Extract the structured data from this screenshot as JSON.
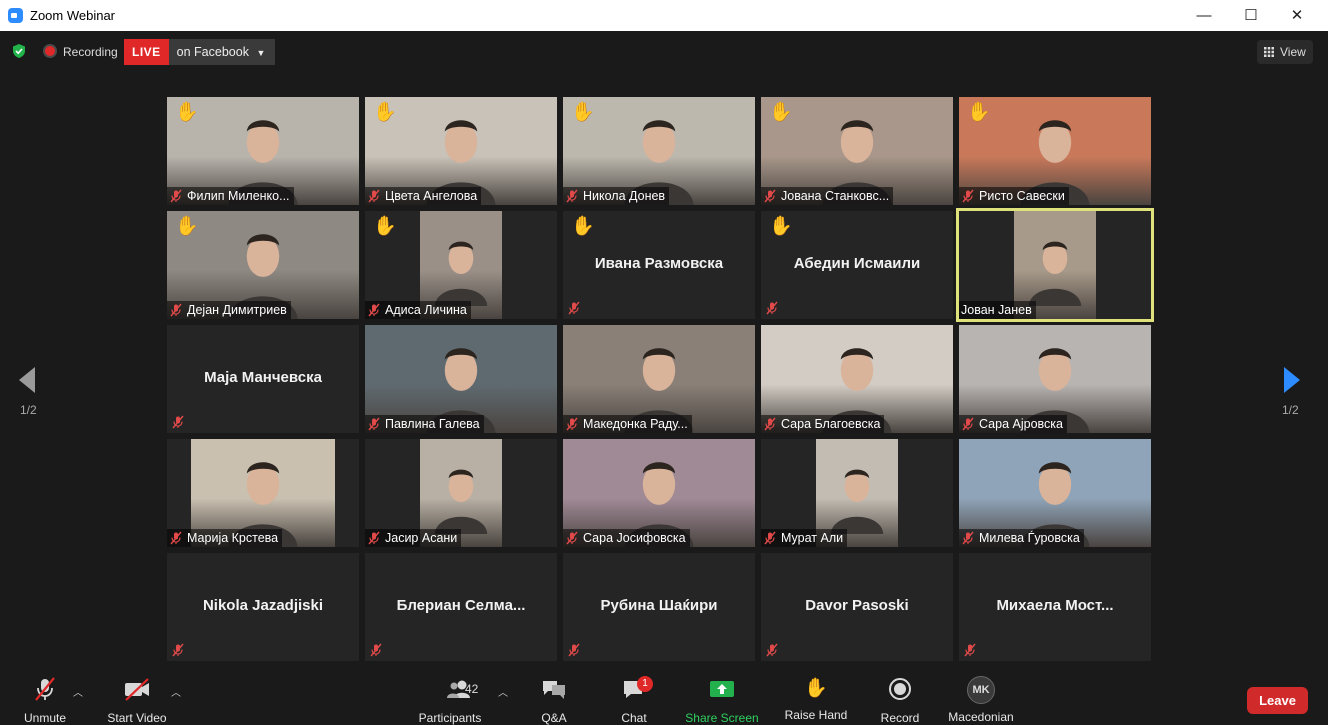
{
  "window": {
    "title": "Zoom Webinar",
    "minimize": "—",
    "maximize": "☐",
    "close": "✕"
  },
  "status": {
    "recording_label": "Recording",
    "live_label": "LIVE",
    "live_destination": "on Facebook",
    "view_label": "View"
  },
  "pagination": {
    "left_page": "1/2",
    "right_page": "1/2"
  },
  "participants": [
    {
      "name": "Филип Миленко...",
      "hand": true,
      "video": true,
      "bg": "#b8b4ac"
    },
    {
      "name": "Цвета Ангелова",
      "hand": true,
      "video": true,
      "bg": "#c8c2b8"
    },
    {
      "name": "Никола Донев",
      "hand": true,
      "video": true,
      "bg": "#bdb8ae"
    },
    {
      "name": "Јована Станковс...",
      "hand": true,
      "video": true,
      "bg": "#a8978a"
    },
    {
      "name": "Ристо Савески",
      "hand": true,
      "video": true,
      "bg": "#c9795a"
    },
    {
      "name": "Дејан Димитриев",
      "hand": true,
      "video": true,
      "bg": "#8f8983"
    },
    {
      "name": "Адиса Личина",
      "hand": true,
      "video": true,
      "bg": "#9a9088"
    },
    {
      "name": "Ивана Размовска",
      "hand": true,
      "video": false
    },
    {
      "name": "Абедин Исмаили",
      "hand": true,
      "video": false
    },
    {
      "name": "Јован Јанев",
      "hand": false,
      "video": true,
      "active": true,
      "bg": "#a89a8a"
    },
    {
      "name": "Маја Манчевска",
      "hand": false,
      "video": false
    },
    {
      "name": "Павлина Галева",
      "hand": false,
      "video": true,
      "bg": "#5f6a70"
    },
    {
      "name": "Македонка Раду...",
      "hand": false,
      "video": true,
      "bg": "#8a8078"
    },
    {
      "name": "Сара Благоевска",
      "hand": false,
      "video": true,
      "bg": "#d2ccc4"
    },
    {
      "name": "Сара Ајровска",
      "hand": false,
      "video": true,
      "bg": "#b8b4b2"
    },
    {
      "name": "Марија Крстева",
      "hand": false,
      "video": true,
      "bg": "#c9c0b0"
    },
    {
      "name": "Јасир Асани",
      "hand": false,
      "video": true,
      "bg": "#b8b0a4"
    },
    {
      "name": "Сара Јосифовска",
      "hand": false,
      "video": true,
      "bg": "#a08a96"
    },
    {
      "name": "Мурат Али",
      "hand": false,
      "video": true,
      "bg": "#c2bcb2"
    },
    {
      "name": "Милева Ѓуровска",
      "hand": false,
      "video": true,
      "bg": "#8fa4b8"
    },
    {
      "name": "Nikola Jazadjiski",
      "hand": false,
      "video": false
    },
    {
      "name": "Блериан  Селма...",
      "hand": false,
      "video": false
    },
    {
      "name": "Рубина Шаќири",
      "hand": false,
      "video": false
    },
    {
      "name": "Davor Pasoski",
      "hand": false,
      "video": false
    },
    {
      "name": "Михаела  Мост...",
      "hand": false,
      "video": false
    }
  ],
  "toolbar": {
    "unmute": "Unmute",
    "start_video": "Start Video",
    "participants": "Participants",
    "participants_count": "42",
    "qa": "Q&A",
    "chat": "Chat",
    "chat_badge": "1",
    "share_screen": "Share Screen",
    "raise_hand": "Raise Hand",
    "record": "Record",
    "language": "Macedonian",
    "language_initials": "MK",
    "leave": "Leave"
  }
}
